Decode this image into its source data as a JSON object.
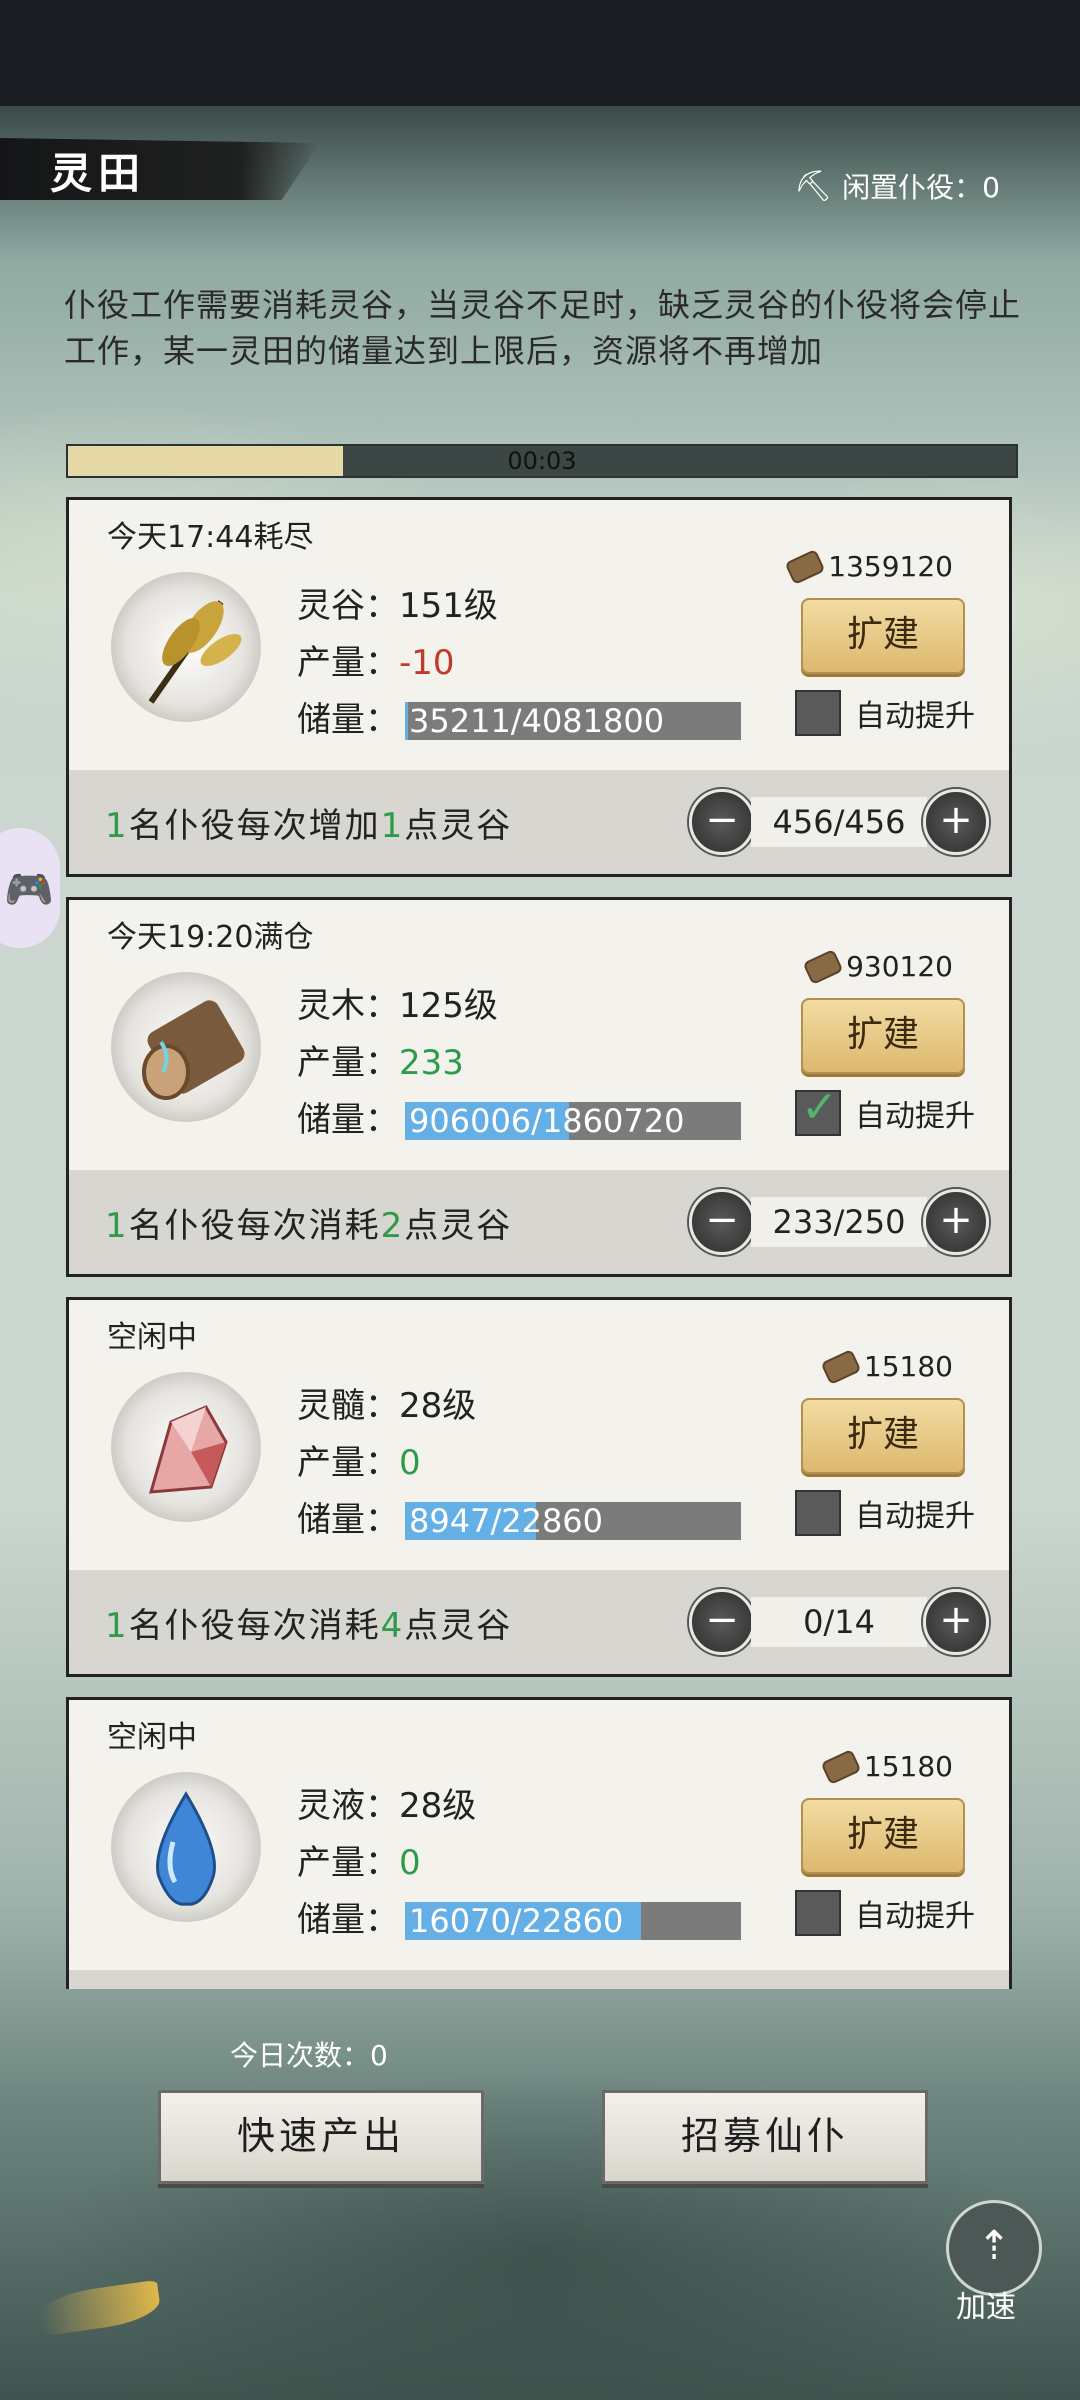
{
  "header": {
    "title": "灵田",
    "idle_label": "闲置仆役：0"
  },
  "description": "仆役工作需要消耗灵谷，当灵谷不足时，缺乏灵谷的仆役将会停止工作，某一灵田的储量达到上限后，资源将不再增加",
  "timer": {
    "text": "00:03",
    "progress": 0.29
  },
  "fields": [
    {
      "status": "今天17:44耗尽",
      "name_level": "灵谷：151级",
      "output_label": "产量：",
      "output_value": "-10",
      "output_sign": "neg",
      "storage_label": "储量：",
      "storage_text": "35211/4081800",
      "storage_fraction": 0.0086,
      "cost": "1359120",
      "expand_label": "扩建",
      "auto_label": "自动提升",
      "auto_checked": false,
      "worker_text_a": "1",
      "worker_text_b": "名仆役每次增加",
      "worker_text_c": "1",
      "worker_text_d": "点灵谷",
      "stepper_value": "456/456",
      "icon": "grain-icon"
    },
    {
      "status": "今天19:20满仓",
      "name_level": "灵木：125级",
      "output_label": "产量：",
      "output_value": "233",
      "output_sign": "pos",
      "storage_label": "储量：",
      "storage_text": "906006/1860720",
      "storage_fraction": 0.487,
      "cost": "930120",
      "expand_label": "扩建",
      "auto_label": "自动提升",
      "auto_checked": true,
      "worker_text_a": "1",
      "worker_text_b": "名仆役每次消耗",
      "worker_text_c": "2",
      "worker_text_d": "点灵谷",
      "stepper_value": "233/250",
      "icon": "wood-log-icon"
    },
    {
      "status": "空闲中",
      "name_level": "灵髓：28级",
      "output_label": "产量：",
      "output_value": "0",
      "output_sign": "pos",
      "storage_label": "储量：",
      "storage_text": "8947/22860",
      "storage_fraction": 0.391,
      "cost": "15180",
      "expand_label": "扩建",
      "auto_label": "自动提升",
      "auto_checked": false,
      "worker_text_a": "1",
      "worker_text_b": "名仆役每次消耗",
      "worker_text_c": "4",
      "worker_text_d": "点灵谷",
      "stepper_value": "0/14",
      "icon": "crystal-icon"
    },
    {
      "status": "空闲中",
      "name_level": "灵液：28级",
      "output_label": "产量：",
      "output_value": "0",
      "output_sign": "pos",
      "storage_label": "储量：",
      "storage_text": "16070/22860",
      "storage_fraction": 0.703,
      "cost": "15180",
      "expand_label": "扩建",
      "auto_label": "自动提升",
      "auto_checked": false,
      "icon": "water-drop-icon"
    }
  ],
  "footer": {
    "today_count": "今日次数：0",
    "fast_output_label": "快速产出",
    "recruit_label": "招募仙仆",
    "speed_label": "加速"
  },
  "colors": {
    "expand_button": "#e6c27d",
    "storage_fill": "#63afe6",
    "positive": "#2e9b4a",
    "negative": "#c0392b"
  }
}
